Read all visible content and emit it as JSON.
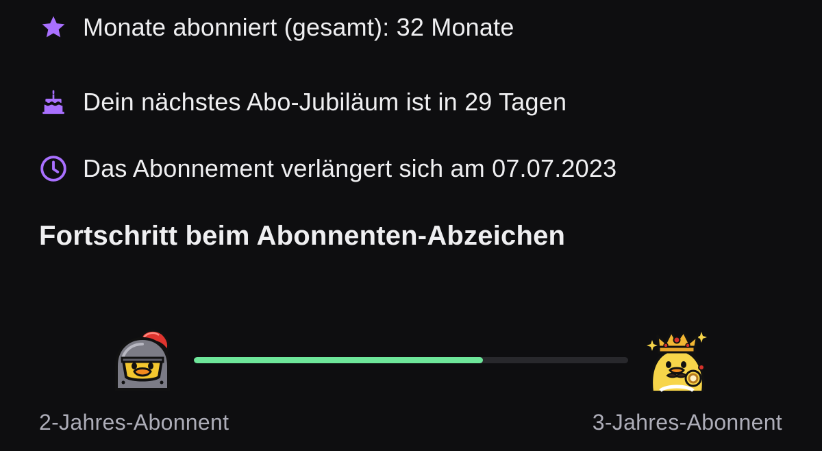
{
  "subscription": {
    "months_text": "Monate abonniert (gesamt): 32 Monate",
    "anniversary_text": "Dein nächstes Abo-Jubiläum ist in 29 Tagen",
    "renewal_text": "Das Abonnement verlängert sich am 07.07.2023"
  },
  "badge_progress": {
    "title": "Fortschritt beim Abonnenten-Abzeichen",
    "progress_fraction": 0.665,
    "current_badge": {
      "label": "2-Jahres-Abonnent",
      "icon": "knight-duck-badge-icon"
    },
    "next_badge": {
      "label": "3-Jahres-Abonnent",
      "icon": "king-duck-badge-icon"
    }
  },
  "icons": {
    "months": "star-icon",
    "anniversary": "cake-icon",
    "renewal": "clock-icon"
  },
  "colors": {
    "background": "#0e0e10",
    "text": "#efeff1",
    "muted_text": "#adadb8",
    "accent_purple": "#a970ff",
    "progress_fill": "#6ee69a",
    "progress_track": "#28282c"
  }
}
